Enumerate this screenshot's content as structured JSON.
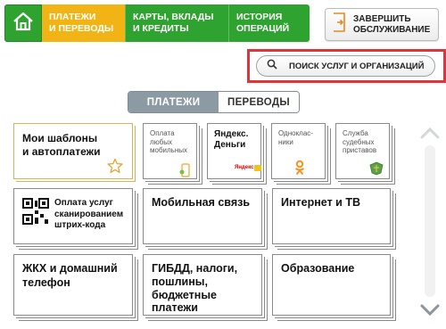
{
  "nav": {
    "tabs": [
      {
        "label": "ПЛАТЕЖИ\nИ ПЕРЕВОДЫ",
        "active": true
      },
      {
        "label": "КАРТЫ, ВКЛАДЫ\nИ КРЕДИТЫ",
        "active": false
      },
      {
        "label": "ИСТОРИЯ\nОПЕРАЦИЙ",
        "active": false
      }
    ],
    "home_icon": "home-icon",
    "colors": {
      "green": "#2fa32f",
      "active": "#f1b414"
    }
  },
  "exit": {
    "label": "ЗАВЕРШИТЬ\nОБСЛУЖИВАНИЕ",
    "icon": "exit-icon"
  },
  "search": {
    "label": "ПОИСК УСЛУГ И ОРГАНИЗАЦИЙ",
    "icon": "search-icon",
    "highlight_color": "#e33238"
  },
  "segments": [
    {
      "label": "ПЛАТЕЖИ",
      "active": true
    },
    {
      "label": "ПЕРЕВОДЫ",
      "active": false
    }
  ],
  "templates_tile": {
    "label": "Мои шаблоны\nи автоплатежи",
    "icon": "star-icon"
  },
  "small_tiles": [
    {
      "label": "Оплата\nлюбых\nмобильных",
      "icon": "phone-icon"
    },
    {
      "label": "Яндекс.\nДеньги",
      "icon": "yandex-money-icon",
      "logo_text": "Яндекс"
    },
    {
      "label": "Одноклас-\nники",
      "icon": "odnoklassniki-icon"
    },
    {
      "label": "Служба\nсудебных\nприставов",
      "icon": "bailiffs-emblem-icon"
    }
  ],
  "qr_tile": {
    "label": "Оплата услуг\nсканированием\nштрих-кода",
    "icon": "qr-code-icon"
  },
  "category_tiles": [
    {
      "label": "Мобильная связь"
    },
    {
      "label": "Интернет и ТВ"
    },
    {
      "label": "ЖКХ и домашний\nтелефон"
    },
    {
      "label": "ГИБДД, налоги,\nпошлины,\nбюджетные\nплатежи"
    },
    {
      "label": "Образование"
    }
  ]
}
